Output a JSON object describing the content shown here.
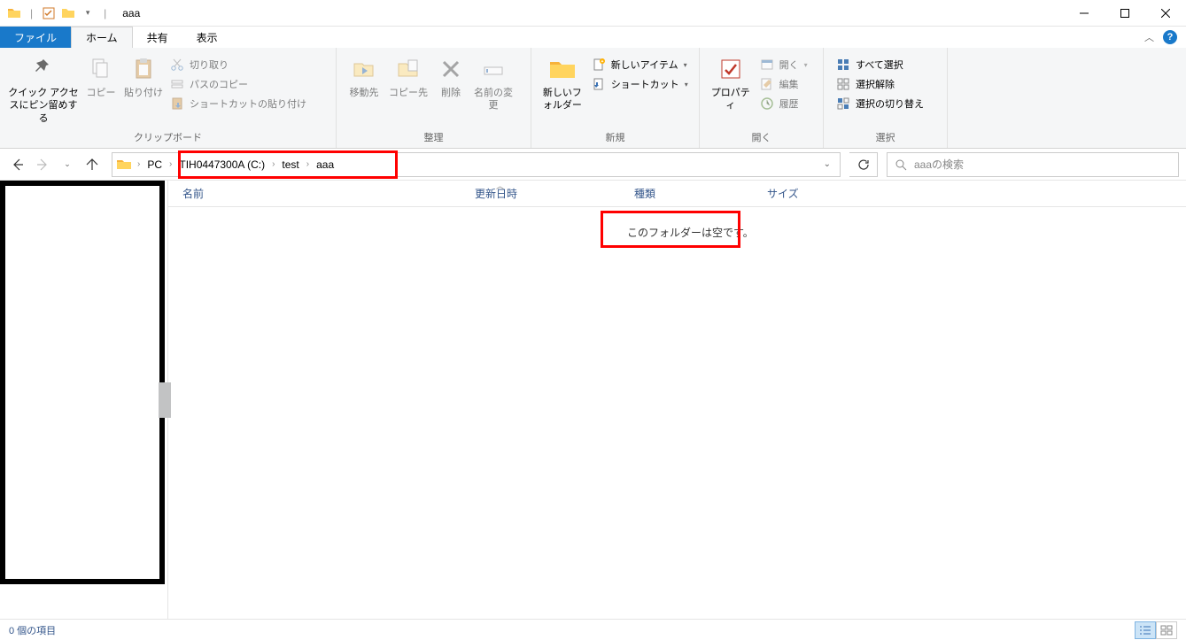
{
  "window": {
    "title": "aaa",
    "minimize": "Minimize",
    "maximize": "Maximize",
    "close": "Close"
  },
  "tabs": {
    "file": "ファイル",
    "home": "ホーム",
    "share": "共有",
    "view": "表示"
  },
  "ribbon": {
    "clipboard": {
      "label": "クリップボード",
      "pin": "クイック アクセスにピン留めする",
      "copy": "コピー",
      "paste": "貼り付け",
      "cut": "切り取り",
      "copy_path": "パスのコピー",
      "paste_shortcut": "ショートカットの貼り付け"
    },
    "organize": {
      "label": "整理",
      "move_to": "移動先",
      "copy_to": "コピー先",
      "delete": "削除",
      "rename": "名前の変更"
    },
    "new": {
      "label": "新規",
      "new_folder": "新しいフォルダー",
      "new_item": "新しいアイテム",
      "shortcut": "ショートカット"
    },
    "open": {
      "label": "開く",
      "properties": "プロパティ",
      "open": "開く",
      "edit": "編集",
      "history": "履歴"
    },
    "select": {
      "label": "選択",
      "select_all": "すべて選択",
      "select_none": "選択解除",
      "invert": "選択の切り替え"
    }
  },
  "breadcrumb": {
    "pc": "PC",
    "drive": "TIH0447300A (C:)",
    "folder1": "test",
    "folder2": "aaa"
  },
  "search": {
    "placeholder": "aaaの検索"
  },
  "columns": {
    "name": "名前",
    "date": "更新日時",
    "type": "種類",
    "size": "サイズ"
  },
  "main": {
    "empty_message": "このフォルダーは空です。"
  },
  "status": {
    "items": "0 個の項目"
  }
}
